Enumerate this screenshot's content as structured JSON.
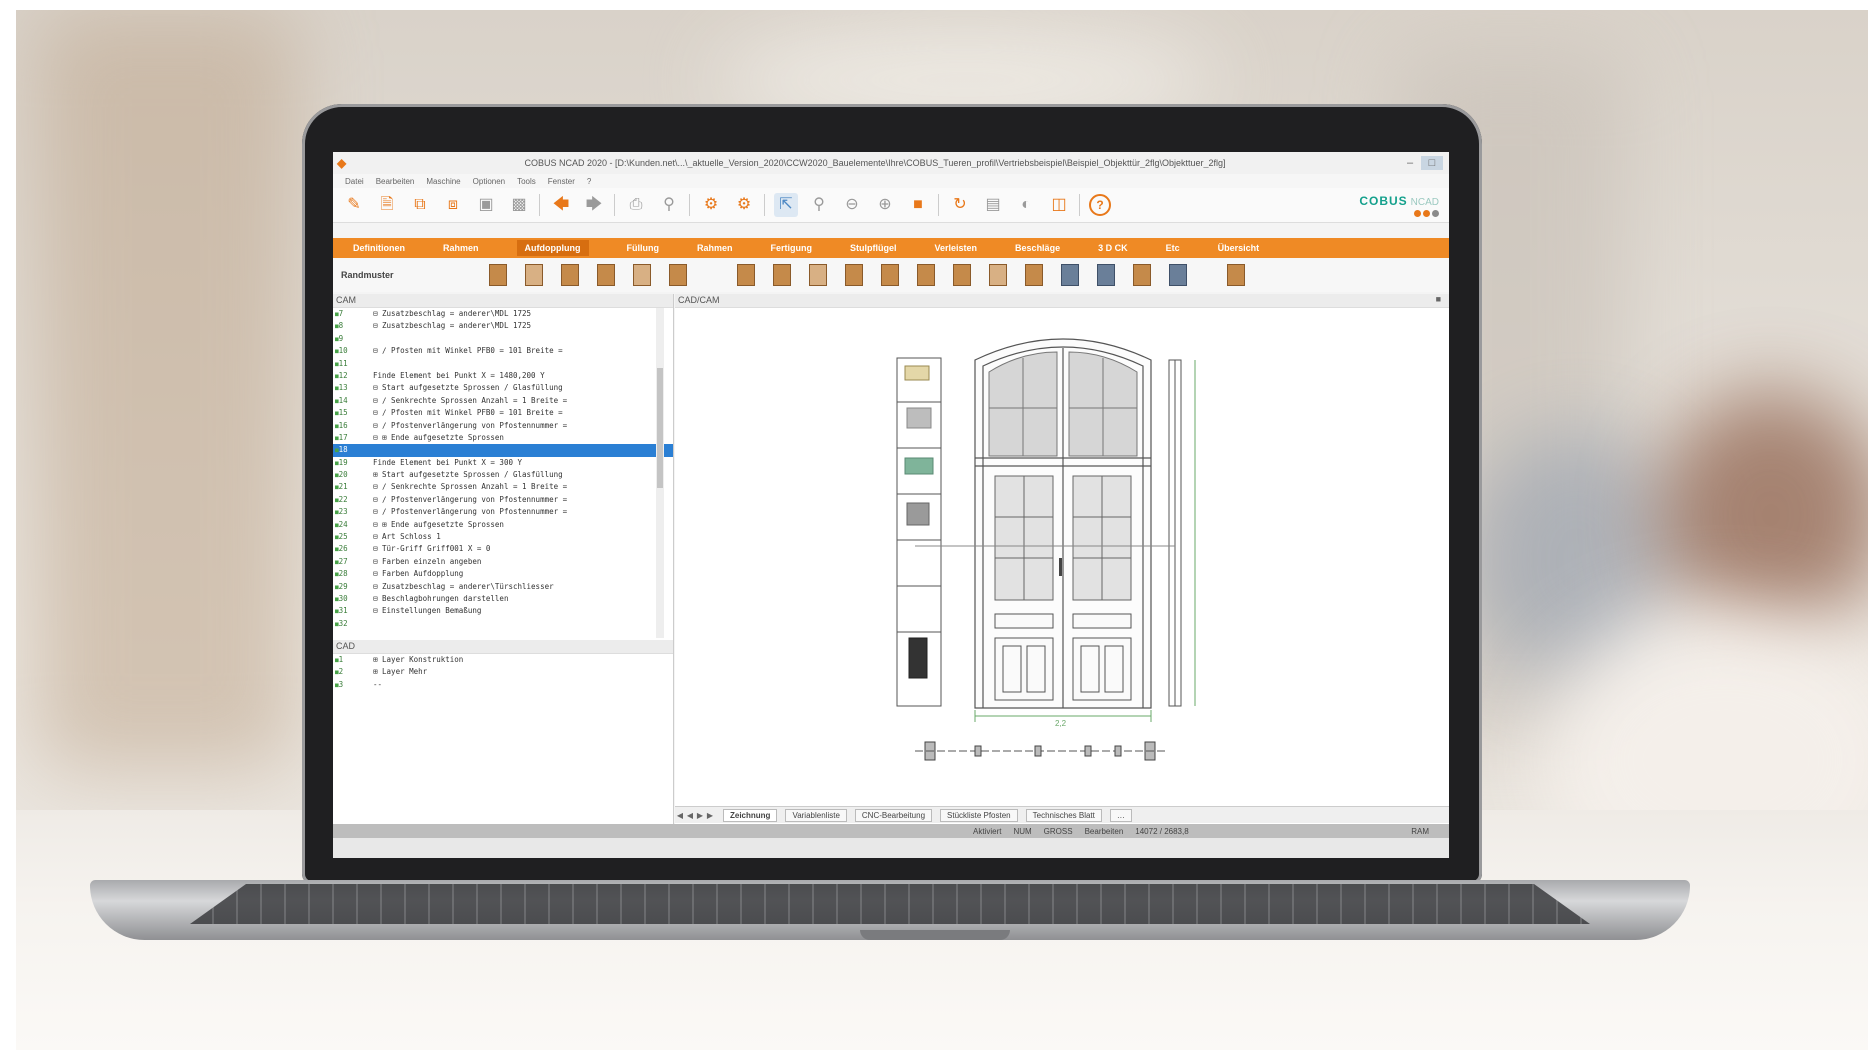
{
  "window": {
    "title": "COBUS NCAD 2020 - [D:\\Kunden.net\\...\\_aktuelle_Version_2020\\CCW2020_Bauelemente\\Ihre\\COBUS_Tueren_profil\\Vertriebsbeispiel\\Beispiel_Objekttür_2flg\\Objekttuer_2flg]",
    "minimize": "–",
    "maximize": "□"
  },
  "menu": [
    "Datei",
    "Bearbeiten",
    "Maschine",
    "Optionen",
    "Tools",
    "Fenster",
    "?"
  ],
  "toolbar": {
    "icons": [
      "pencil-icon",
      "document-icon",
      "copy-icon",
      "paste-icon",
      "save-icon",
      "save-all-icon",
      "arrow-left-icon",
      "arrow-right-icon",
      "print-icon",
      "preview-icon",
      "gear-icon",
      "gear-alt-icon",
      "select-icon",
      "zoom-icon",
      "zoom-out-icon",
      "zoom-in-icon",
      "stop-icon",
      "refresh-icon",
      "clipboard-icon",
      "render-icon",
      "cube-icon",
      "help-icon"
    ]
  },
  "brand": {
    "name": "COBUS",
    "sub": "NCAD"
  },
  "ribbon": {
    "tabs": [
      "Definitionen",
      "Rahmen",
      "Aufdopplung",
      "Füllung",
      "Rahmen",
      "Fertigung",
      "Stulpflügel",
      "Verleisten",
      "Beschläge",
      "3 D CK",
      "Etc",
      "Übersicht"
    ],
    "active_index": 2
  },
  "subtoolbar": {
    "label": "Randmuster"
  },
  "cam": {
    "title": "CAM",
    "rows": [
      {
        "n": "7",
        "c": "  ⊟ Zusatzbeschlag     = anderer\\MDL 1725"
      },
      {
        "n": "8",
        "c": "  ⊟ Zusatzbeschlag     = anderer\\MDL 1725"
      },
      {
        "n": "9",
        "c": ""
      },
      {
        "n": "10",
        "c": "  ⊟ ∕ Pfosten mit Winkel PFB0 = 101 Breite ="
      },
      {
        "n": "11",
        "c": ""
      },
      {
        "n": "12",
        "c": "Finde Element bei Punkt  X = 1480,200   Y"
      },
      {
        "n": "13",
        "c": "  ⊟ Start aufgesetzte Sprossen / Glasfüllung"
      },
      {
        "n": "14",
        "c": "  ⊟ ∕ Senkrechte Sprossen Anzahl = 1 Breite ="
      },
      {
        "n": "15",
        "c": "  ⊟ ∕ Pfosten mit Winkel PFB0 = 101 Breite ="
      },
      {
        "n": "16",
        "c": "  ⊟ ∕ Pfostenverlängerung von Pfostennummer ="
      },
      {
        "n": "17",
        "c": "  ⊟ ⊞ Ende aufgesetzte Sprossen"
      },
      {
        "n": "18",
        "c": ""
      },
      {
        "n": "19",
        "c": "Finde Element bei Punkt  X = 300        Y"
      },
      {
        "n": "20",
        "c": "  ⊞ Start aufgesetzte Sprossen / Glasfüllung"
      },
      {
        "n": "21",
        "c": "  ⊟ ∕ Senkrechte Sprossen Anzahl = 1 Breite ="
      },
      {
        "n": "22",
        "c": "  ⊟ ∕ Pfostenverlängerung von Pfostennummer ="
      },
      {
        "n": "23",
        "c": "  ⊟ ∕ Pfostenverlängerung von Pfostennummer ="
      },
      {
        "n": "24",
        "c": "  ⊟ ⊞ Ende aufgesetzte Sprossen"
      },
      {
        "n": "25",
        "c": "  ⊟ Art Schloss       1"
      },
      {
        "n": "26",
        "c": "  ⊟ Tür-Griff         Griff001   X = 0"
      },
      {
        "n": "27",
        "c": "  ⊟ Farben einzeln angeben"
      },
      {
        "n": "28",
        "c": "  ⊟ Farben Aufdopplung"
      },
      {
        "n": "29",
        "c": "  ⊟ Zusatzbeschlag     = anderer\\Türschliesser"
      },
      {
        "n": "30",
        "c": "  ⊟ Beschlagbohrungen darstellen"
      },
      {
        "n": "31",
        "c": "  ⊟ Einstellungen Bemaßung"
      },
      {
        "n": "32",
        "c": ""
      }
    ],
    "selected_row": "18"
  },
  "cad": {
    "title": "CAD",
    "rows": [
      {
        "n": "1",
        "c": "  ⊞ Layer             Konstruktion"
      },
      {
        "n": "2",
        "c": "  ⊞ Layer             Mehr"
      },
      {
        "n": "3",
        "c": "  --"
      }
    ]
  },
  "canvas": {
    "title": "CAD/CAM",
    "dimension": "2,2",
    "pin": "■"
  },
  "sheet_tabs": [
    "Zeichnung",
    "Variablenliste",
    "CNC-Bearbeitung",
    "Stückliste Pfosten",
    "Technisches Blatt",
    "…"
  ],
  "active_sheet": 0,
  "status": [
    "Aktiviert",
    "NUM",
    "GROSS",
    "Bearbeiten",
    "14072 / 2683,8"
  ],
  "status_right": "RAM"
}
